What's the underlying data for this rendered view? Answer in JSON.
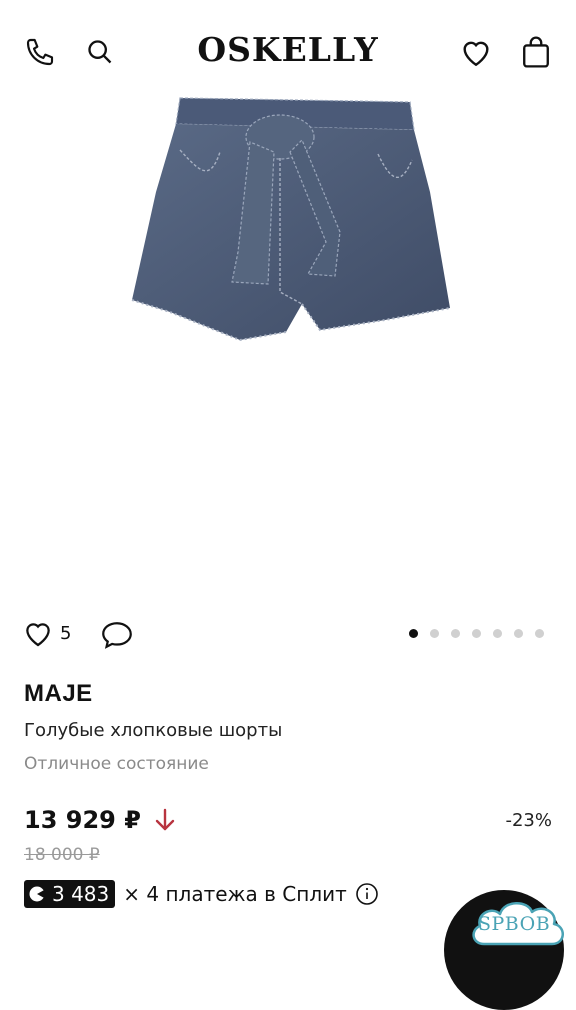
{
  "header": {
    "logo": "OSKELLY",
    "icons": [
      "phone-icon",
      "search-icon",
      "heart-icon",
      "bag-icon"
    ]
  },
  "product": {
    "image_desc_icon": "denim-shorts-image",
    "likes": "5",
    "carousel": {
      "total": 7,
      "active": 1
    },
    "brand": "MAJE",
    "title": "Голубые хлопковые шорты",
    "condition": "Отличное состояние",
    "price": "13 929 ₽",
    "old_price": "18 000 ₽",
    "discount": "-23%",
    "split": {
      "amount": "3 483",
      "text": "× 4 платежа в Сплит"
    }
  },
  "watermark": {
    "text": "SPBOB"
  },
  "colors": {
    "accent_arrow": "#b8343f",
    "watermark": "#4aa3b5"
  }
}
